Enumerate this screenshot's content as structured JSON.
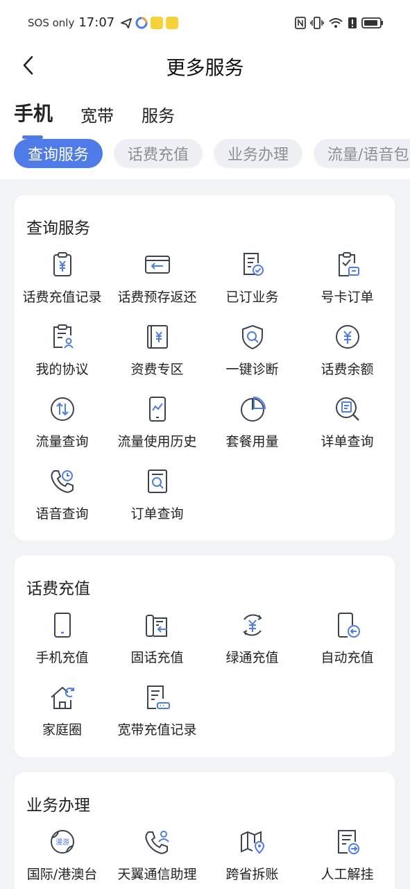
{
  "status_bar": {
    "carrier": "SOS only",
    "time": "17:07"
  },
  "header": {
    "title": "更多服务"
  },
  "main_tabs": [
    "手机",
    "宽带",
    "服务"
  ],
  "sub_tabs": [
    "查询服务",
    "话费充值",
    "业务办理",
    "流量/语音包"
  ],
  "sections": [
    {
      "title": "查询服务",
      "items": [
        {
          "label": "话费充值记录",
          "icon": "clipboard-yuan-icon"
        },
        {
          "label": "话费预存返还",
          "icon": "card-return-icon"
        },
        {
          "label": "已订业务",
          "icon": "document-check-icon"
        },
        {
          "label": "号卡订单",
          "icon": "clipboard-card-icon"
        },
        {
          "label": "我的协议",
          "icon": "document-user-icon"
        },
        {
          "label": "资费专区",
          "icon": "book-yuan-icon"
        },
        {
          "label": "一键诊断",
          "icon": "shield-search-icon"
        },
        {
          "label": "话费余额",
          "icon": "circle-yuan-icon"
        },
        {
          "label": "流量查询",
          "icon": "circle-arrows-icon"
        },
        {
          "label": "流量使用历史",
          "icon": "phone-chart-icon"
        },
        {
          "label": "套餐用量",
          "icon": "pie-chart-icon"
        },
        {
          "label": "详单查询",
          "icon": "search-list-icon"
        },
        {
          "label": "语音查询",
          "icon": "phone-clock-icon"
        },
        {
          "label": "订单查询",
          "icon": "document-search-icon"
        }
      ]
    },
    {
      "title": "话费充值",
      "items": [
        {
          "label": "手机充值",
          "icon": "mobile-phone-icon"
        },
        {
          "label": "固话充值",
          "icon": "landline-icon"
        },
        {
          "label": "绿通充值",
          "icon": "circle-yuan-arrows-icon"
        },
        {
          "label": "自动充值",
          "icon": "phone-arrow-icon"
        },
        {
          "label": "家庭圈",
          "icon": "home-refresh-icon"
        },
        {
          "label": "宽带充值记录",
          "icon": "document-router-icon"
        }
      ]
    },
    {
      "title": "业务办理",
      "items": [
        {
          "label": "国际/港澳台",
          "icon": "globe-roaming-icon"
        },
        {
          "label": "天翼通信助理",
          "icon": "phone-user-icon"
        },
        {
          "label": "跨省拆账",
          "icon": "map-pin-icon"
        },
        {
          "label": "人工解挂",
          "icon": "document-arrow-icon"
        }
      ]
    }
  ],
  "roaming_badge_text": "漫游",
  "colors": {
    "accent": "#4e7be8",
    "icon_stroke": "#3c4350",
    "chip_bg": "#eef0f3",
    "chip_text": "#8a8f99",
    "page_bg": "#f2f3f5"
  }
}
